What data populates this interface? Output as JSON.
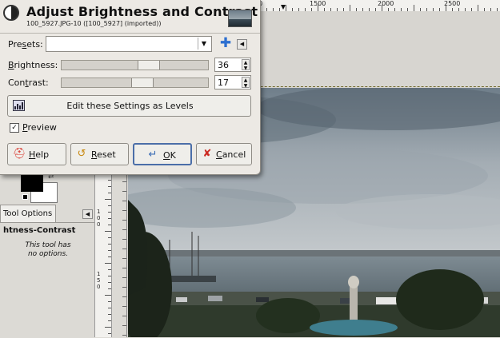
{
  "dialog": {
    "title": "Adjust Brightness and Contrast",
    "subtitle": "100_5927.JPG-10 ([100_5927] (imported))",
    "presets_label_a": "Pre",
    "presets_label_u": "s",
    "presets_label_b": "ets:",
    "brightness_label_u": "B",
    "brightness_label_rest": "rightness:",
    "brightness_value": "36",
    "brightness_fraction": 0.59,
    "contrast_label_a": "Con",
    "contrast_label_u": "t",
    "contrast_label_b": "rast:",
    "contrast_value": "17",
    "contrast_fraction": 0.545,
    "levels_button": "Edit these Settings as Levels",
    "preview_checked": true,
    "preview_label_u": "P",
    "preview_label_rest": "review",
    "buttons": {
      "help_u": "H",
      "help_rest": "elp",
      "reset_u": "R",
      "reset_rest": "eset",
      "ok_u": "O",
      "ok_rest": "K",
      "cancel_u": "C",
      "cancel_rest": "ancel"
    },
    "icons": {
      "header": "brightness-contrast-icon",
      "add": "add-preset-icon",
      "help": "lifebuoy-icon",
      "reset": "reset-icon",
      "ok": "ok-arrow-icon",
      "cancel": "cancel-x-icon"
    }
  },
  "ruler": {
    "top_labels": [
      "00",
      "1500",
      "2000",
      "2500"
    ],
    "left_labels": [
      "1",
      "0",
      "0",
      "1",
      "5",
      "0"
    ]
  },
  "dock": {
    "tab_label": "Tool Options",
    "tool_name": "htness-Contrast",
    "note_line1": "This tool has",
    "note_line2": "no options."
  },
  "colors": {
    "dialog_bg": "#ece9e4",
    "accent_plus": "#2d6fd0",
    "help_red": "#d8382e",
    "ok_border": "#4b6ea8"
  }
}
